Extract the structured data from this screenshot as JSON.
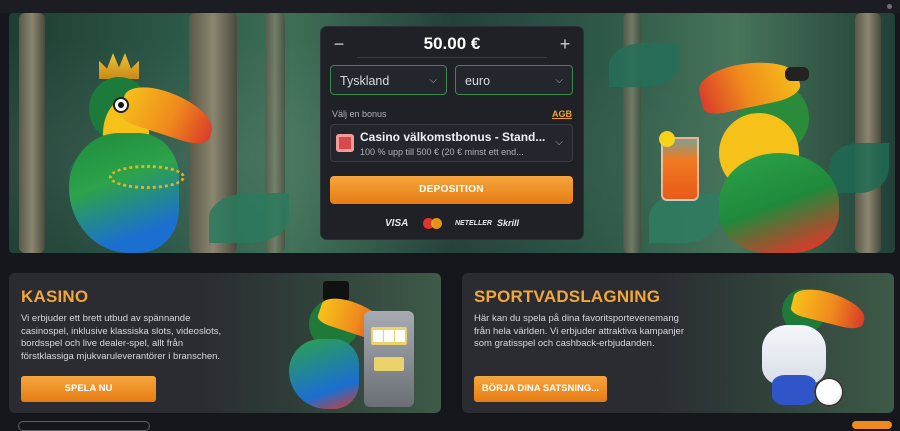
{
  "deposit": {
    "minus": "−",
    "plus": "+",
    "amount": "50.00 €",
    "country": "Tyskland",
    "currency": "euro",
    "bonus_label": "Välj en bonus",
    "agb": "AGB",
    "bonus_title": "Casino välkomstbonus - Stand...",
    "bonus_subtitle": "100 % upp till 500 € (20 € minst ett end...",
    "deposit_button": "DEPOSITION",
    "payments": [
      "VISA",
      "mastercard",
      "NETELLER",
      "Skrill"
    ]
  },
  "cards": {
    "kasino": {
      "title": "KASINO",
      "text": "Vi erbjuder ett brett utbud av spännande casinospel, inklusive klassiska slots, videoslots, bordsspel och live dealer-spel, allt från förstklassiga mjukvaruleverantörer i branschen.",
      "button": "SPELA NU"
    },
    "sport": {
      "title": "SPORTVADSLAGNING",
      "text": "Här kan du spela på dina favoritsportevenemang från hela världen. Vi erbjuder attraktiva kampanjer som gratisspel och cashback-erbjudanden.",
      "button": "BÖRJA DINA SATSNING..."
    }
  },
  "icons": {
    "chevron": "chevron-down-icon",
    "gift": "gift-icon"
  },
  "colors": {
    "accent": "#f08a1c",
    "title_orange": "#f3a63a",
    "panel_bg": "#1f2127",
    "select_border": "#3a8a4c"
  }
}
